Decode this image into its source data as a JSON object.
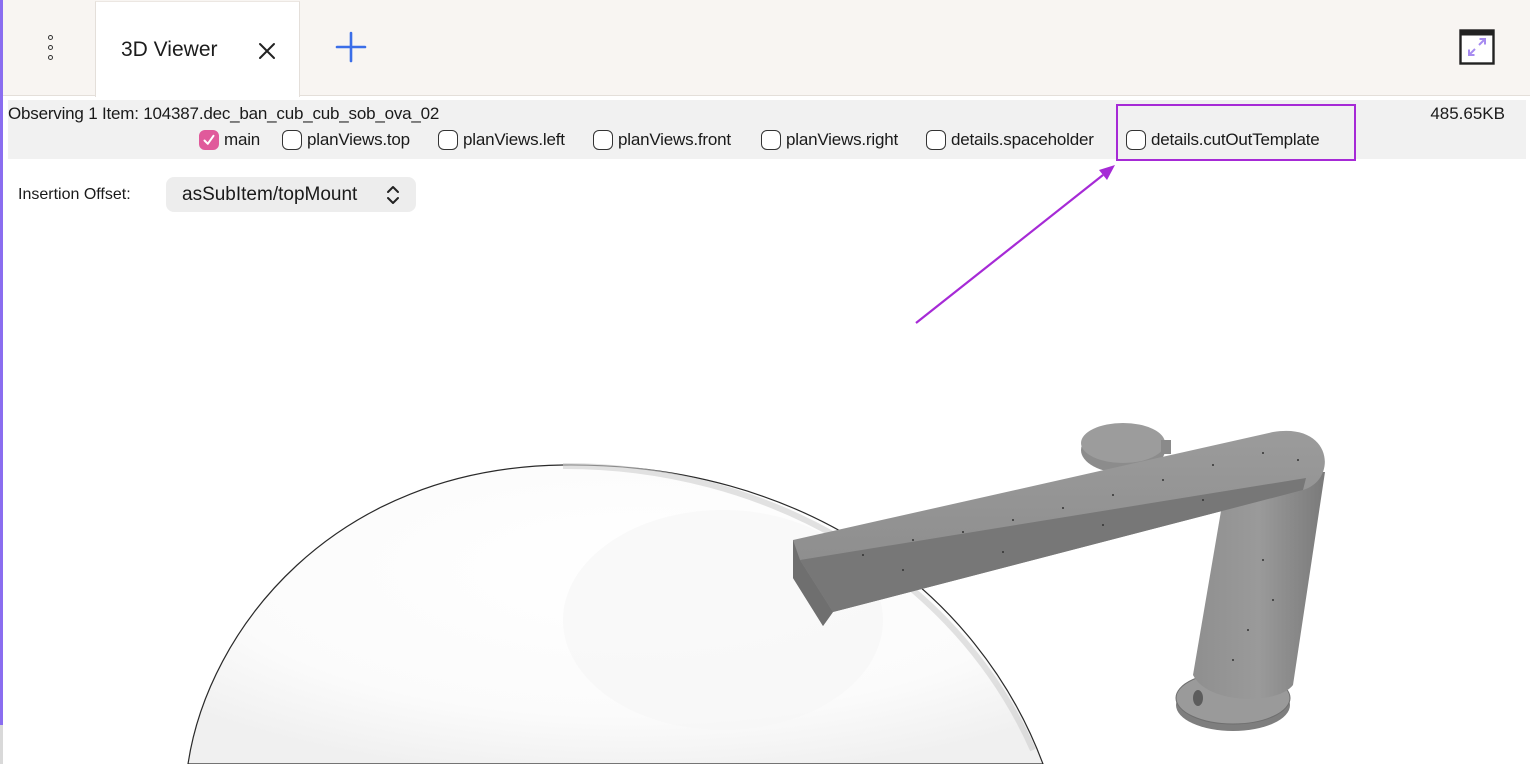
{
  "tabbar": {
    "menu_icon": "vertical-dots-icon",
    "tabs": [
      {
        "label": "3D Viewer",
        "close_icon": "close-icon"
      }
    ],
    "add_icon": "plus-icon",
    "window_icon": "minimize-window-icon"
  },
  "info": {
    "observing": "Observing 1 Item: 104387.dec_ban_cub_cub_sob_ova_02",
    "filesize": "485.65KB"
  },
  "layers": [
    {
      "label": "main",
      "checked": true
    },
    {
      "label": "planViews.top",
      "checked": false
    },
    {
      "label": "planViews.left",
      "checked": false
    },
    {
      "label": "planViews.front",
      "checked": false
    },
    {
      "label": "planViews.right",
      "checked": false
    },
    {
      "label": "details.spaceholder",
      "checked": false
    },
    {
      "label": "details.cutOutTemplate",
      "checked": false
    }
  ],
  "insertion_offset": {
    "label": "Insertion Offset:",
    "value": "asSubItem/topMount"
  },
  "colors": {
    "accent": "#3b6ee8",
    "checkbox_checked": "#e05a9b",
    "annotation": "#a62ad6",
    "faucet": "#8c8c8c",
    "basin": "#ffffff"
  }
}
